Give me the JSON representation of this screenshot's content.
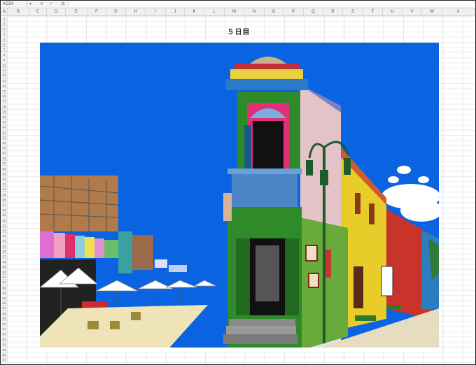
{
  "formula_bar": {
    "name_box": "AC54",
    "fx_label": "fx",
    "cancel_glyph": "✕",
    "enter_glyph": "✓",
    "formula": ""
  },
  "columns": [
    "A",
    "B",
    "C",
    "D",
    "E",
    "F",
    "G",
    "H",
    "I",
    "J",
    "K",
    "L",
    "M",
    "N",
    "O",
    "P",
    "Q",
    "R",
    "S",
    "T",
    "U",
    "V",
    "W",
    "X"
  ],
  "rows": [
    "1",
    "2",
    "3",
    "4",
    "5",
    "6",
    "7",
    "8",
    "9",
    "10",
    "11",
    "12",
    "13",
    "14",
    "15",
    "16",
    "17",
    "18",
    "19",
    "20",
    "21",
    "22",
    "23",
    "24",
    "25",
    "26",
    "27",
    "28",
    "29",
    "30",
    "31",
    "32",
    "33",
    "34",
    "35",
    "36",
    "37",
    "38",
    "39",
    "40",
    "41",
    "42",
    "43",
    "44",
    "45",
    "46",
    "47",
    "48",
    "49",
    "50",
    "51",
    "52",
    "53",
    "54",
    "55",
    "56",
    "57",
    "58",
    "59",
    "60",
    "61",
    "62",
    "63",
    "64",
    "65",
    "66",
    "67"
  ],
  "sheet": {
    "title": "５日目"
  },
  "picture": {
    "icon": "street-scene-illustration-icon",
    "colors": {
      "sky": "#0a63e0",
      "building_green": "#2f8a2a",
      "building_yellow": "#e8cc2a",
      "building_red": "#c8332a",
      "balcony_blue": "#4a86c8",
      "pink": "#e0307a",
      "pavement": "#efe4b8"
    }
  }
}
